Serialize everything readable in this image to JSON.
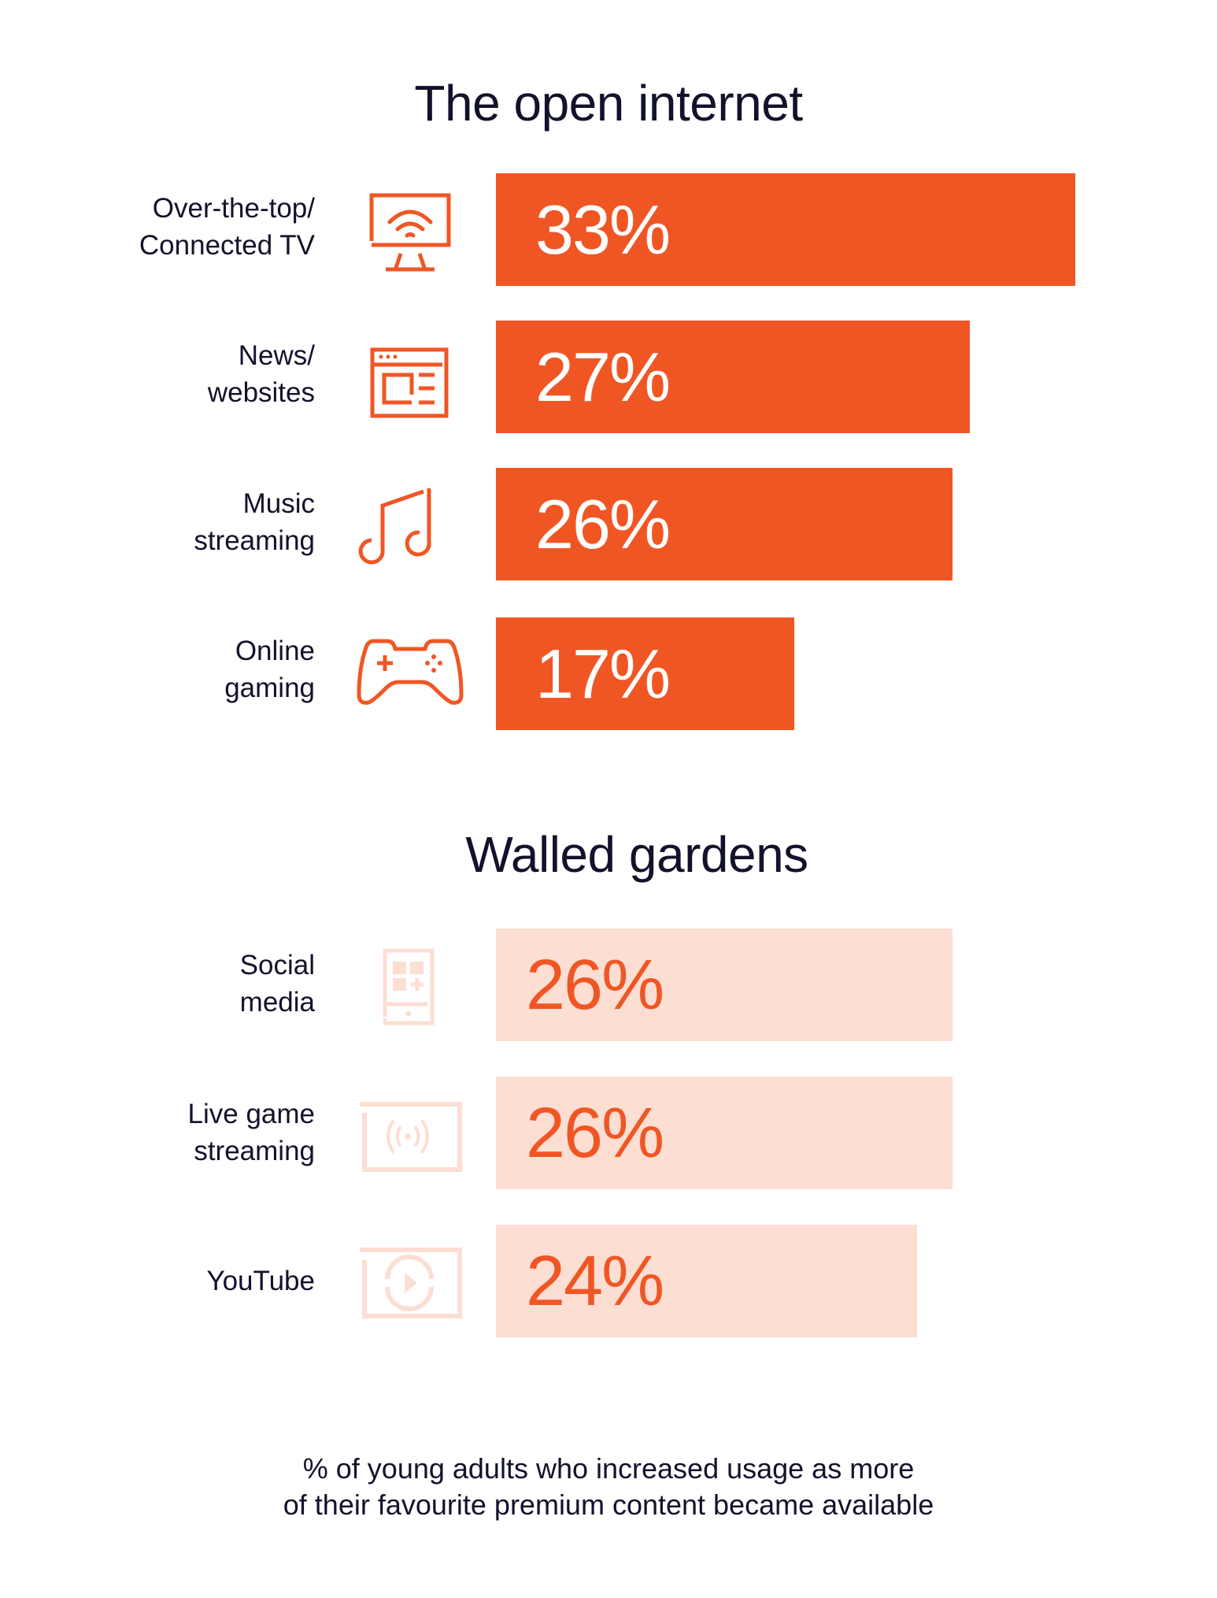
{
  "chart_data": {
    "type": "bar",
    "orientation": "horizontal",
    "unit": "%",
    "xlim": [
      0,
      33
    ],
    "groups": [
      {
        "title": "The open internet",
        "color": "#F05624",
        "value_text_color": "#FFFFFF",
        "categories": [
          {
            "label": "Over-the-top/\nConnected TV",
            "icon": "connected-tv-icon",
            "value": 33,
            "value_label": "33%"
          },
          {
            "label": "News/\nwebsites",
            "icon": "browser-window-icon",
            "value": 27,
            "value_label": "27%"
          },
          {
            "label": "Music\nstreaming",
            "icon": "music-note-icon",
            "value": 26,
            "value_label": "26%"
          },
          {
            "label": "Online\ngaming",
            "icon": "game-controller-icon",
            "value": 17,
            "value_label": "17%"
          }
        ]
      },
      {
        "title": "Walled gardens",
        "color": "#FCDED3",
        "value_text_color": "#F05624",
        "categories": [
          {
            "label": "Social\nmedia",
            "icon": "mobile-app-icon",
            "value": 26,
            "value_label": "26%"
          },
          {
            "label": "Live game\nstreaming",
            "icon": "live-stream-icon",
            "value": 26,
            "value_label": "26%"
          },
          {
            "label": "YouTube",
            "icon": "video-play-icon",
            "value": 24,
            "value_label": "24%"
          }
        ]
      }
    ],
    "caption": "% of young adults who increased usage as more\nof their favourite premium content became available",
    "grid": false,
    "legend": "none"
  }
}
